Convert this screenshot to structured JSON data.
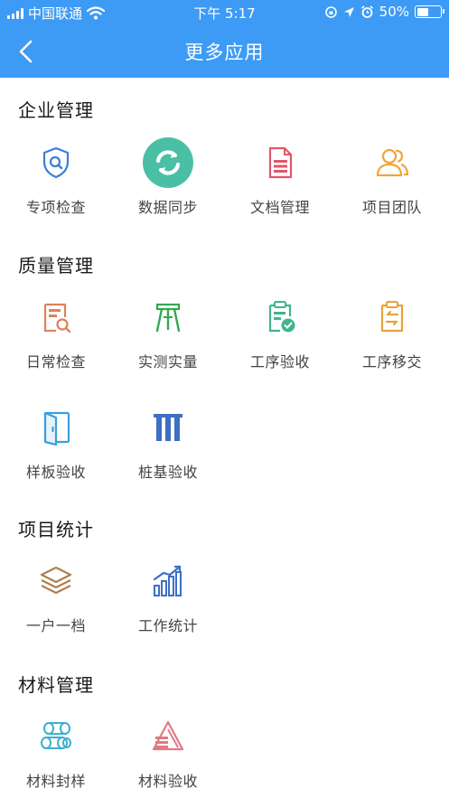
{
  "status_bar": {
    "carrier": "中国联通",
    "time": "下午 5:17",
    "battery": "50%"
  },
  "nav": {
    "title": "更多应用"
  },
  "sections": [
    {
      "title": "企业管理",
      "items": [
        {
          "label": "专项检查",
          "icon": "shield-search-icon"
        },
        {
          "label": "数据同步",
          "icon": "sync-icon"
        },
        {
          "label": "文档管理",
          "icon": "document-icon"
        },
        {
          "label": "项目团队",
          "icon": "team-icon"
        }
      ]
    },
    {
      "title": "质量管理",
      "items": [
        {
          "label": "日常检查",
          "icon": "daily-check-icon"
        },
        {
          "label": "实测实量",
          "icon": "measure-icon"
        },
        {
          "label": "工序验收",
          "icon": "process-accept-icon"
        },
        {
          "label": "工序移交",
          "icon": "process-transfer-icon"
        },
        {
          "label": "样板验收",
          "icon": "sample-door-icon"
        },
        {
          "label": "桩基验收",
          "icon": "pile-icon"
        }
      ]
    },
    {
      "title": "项目统计",
      "items": [
        {
          "label": "一户一档",
          "icon": "layers-icon"
        },
        {
          "label": "工作统计",
          "icon": "bar-stats-icon"
        }
      ]
    },
    {
      "title": "材料管理",
      "items": [
        {
          "label": "材料封样",
          "icon": "material-seal-icon"
        },
        {
          "label": "材料验收",
          "icon": "material-accept-icon"
        }
      ]
    }
  ]
}
